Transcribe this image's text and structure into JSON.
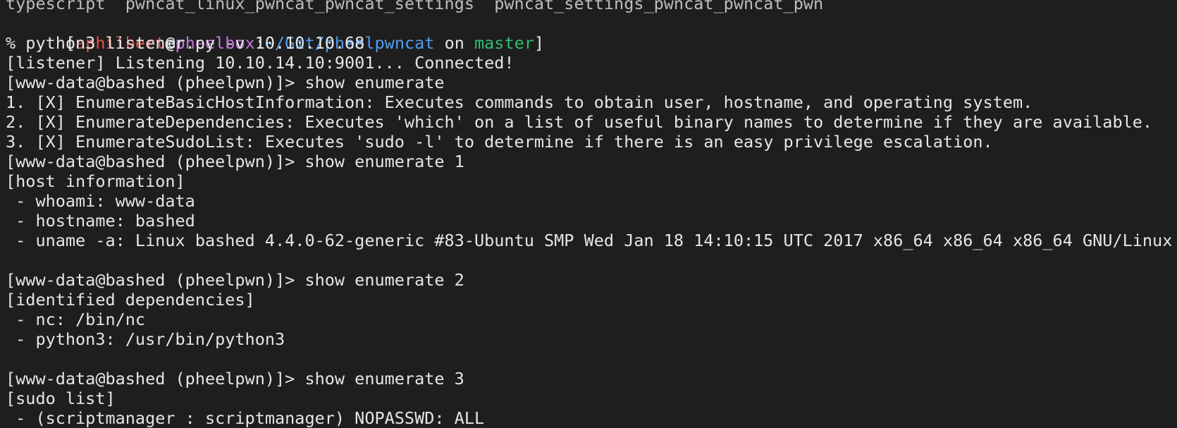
{
  "colors": {
    "background": "#1e1e1e",
    "text": "#e6e6e6",
    "user": "#e5534b",
    "host": "#c678dd",
    "path": "#4f9cf0",
    "branch": "#2fbf71"
  },
  "terminal": {
    "clipped_top_line": "typescript  pwncat_linux_pwncat_pwncat_settings  pwncat_settings_pwncat_pwncat_pwn",
    "prompt": {
      "open_bracket": "[",
      "user": "aphilbert",
      "at": "@",
      "host": "pheelbox",
      "colon": ":",
      "path": "~/Git/pheelpwncat",
      "on": " on ",
      "branch": "master",
      "close_bracket": "]"
    },
    "lines": [
      "% python3 listener.py -v 10.10.10.68",
      "[listener] Listening 10.10.14.10:9001... Connected!",
      "[www-data@bashed (pheelpwn)]> show enumerate",
      "1. [X] EnumerateBasicHostInformation: Executes commands to obtain user, hostname, and operating system.",
      "2. [X] EnumerateDependencies: Executes 'which' on a list of useful binary names to determine if they are available.",
      "3. [X] EnumerateSudoList: Executes 'sudo -l' to determine if there is an easy privilege escalation.",
      "[www-data@bashed (pheelpwn)]> show enumerate 1",
      "[host information]",
      " - whoami: www-data",
      " - hostname: bashed",
      " - uname -a: Linux bashed 4.4.0-62-generic #83-Ubuntu SMP Wed Jan 18 14:10:15 UTC 2017 x86_64 x86_64 x86_64 GNU/Linux",
      "",
      "[www-data@bashed (pheelpwn)]> show enumerate 2",
      "[identified dependencies]",
      " - nc: /bin/nc",
      " - python3: /usr/bin/python3",
      "",
      "[www-data@bashed (pheelpwn)]> show enumerate 3",
      "[sudo list]",
      " - (scriptmanager : scriptmanager) NOPASSWD: ALL"
    ]
  }
}
